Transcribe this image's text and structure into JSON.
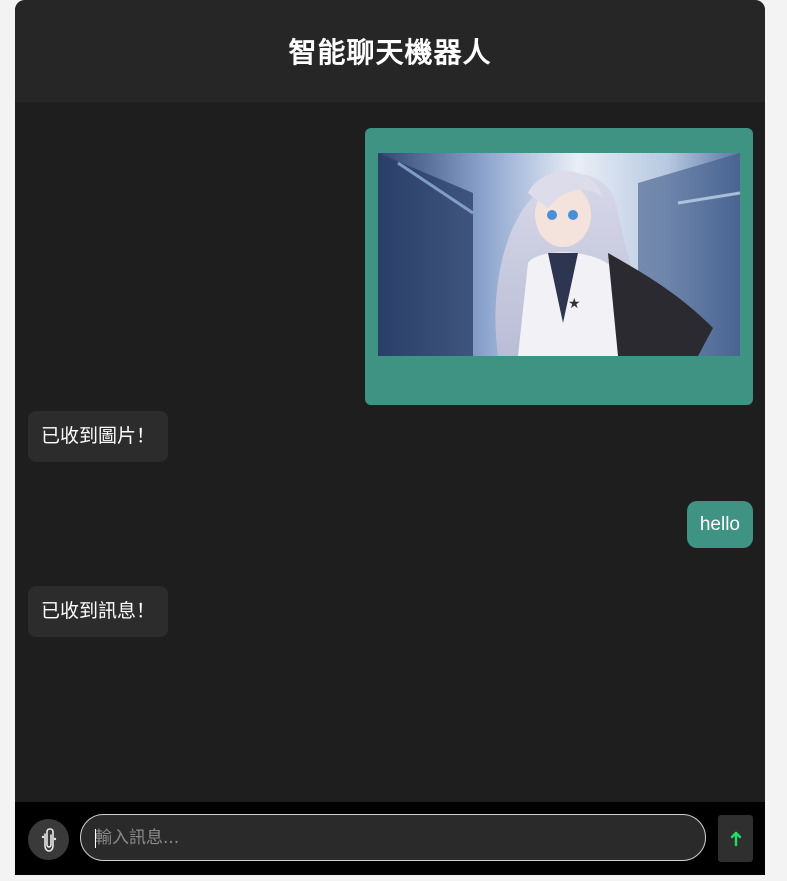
{
  "header": {
    "title": "智能聊天機器人"
  },
  "messages": [
    {
      "role": "user",
      "kind": "image",
      "image_description_icon": "anime-girl-image"
    },
    {
      "role": "bot",
      "kind": "text",
      "text": "已收到圖片！"
    },
    {
      "role": "user",
      "kind": "text",
      "text": "hello"
    },
    {
      "role": "bot",
      "kind": "text",
      "text": "已收到訊息！"
    }
  ],
  "composer": {
    "placeholder": "輸入訊息...",
    "value": "",
    "attach_icon": "paperclip-icon",
    "send_icon": "arrow-up-icon"
  },
  "colors": {
    "user_bubble": "#3f9383",
    "bot_bubble": "#2c2c2c",
    "send_arrow": "#22dd66"
  }
}
